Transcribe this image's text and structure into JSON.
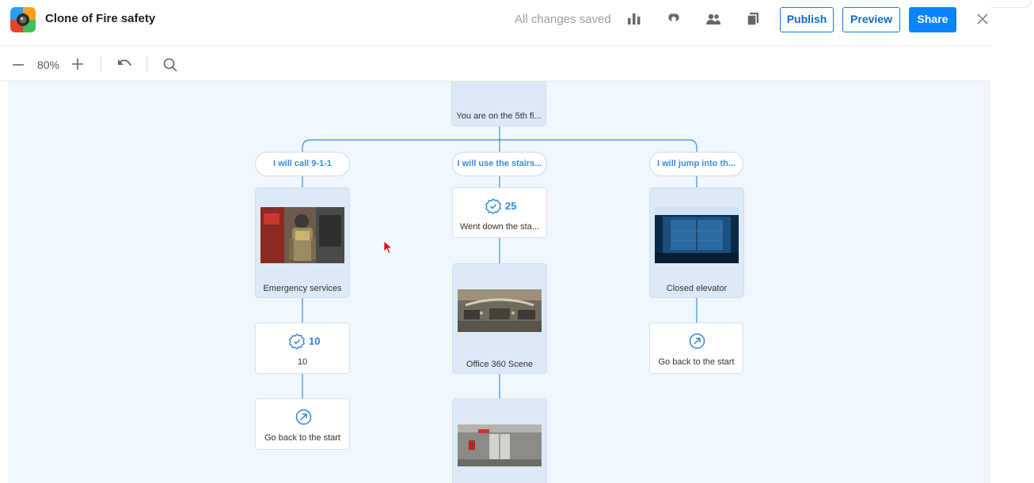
{
  "header": {
    "project_title": "Clone of Fire safety",
    "save_status": "All changes saved",
    "buttons": {
      "publish": "Publish",
      "preview": "Preview",
      "share": "Share"
    },
    "icons": [
      "stats-icon",
      "settings-icon",
      "collaborators-icon",
      "duplicate-icon",
      "close-icon"
    ]
  },
  "toolbar": {
    "zoom_level": "80%"
  },
  "tree": {
    "root": {
      "label": "You are on the 5th fl..."
    },
    "choices": [
      {
        "label": "I will call 9-1-1"
      },
      {
        "label": "I will use the stairs..."
      },
      {
        "label": "I will jump into th..."
      }
    ],
    "left": {
      "scene": {
        "label": "Emergency services"
      },
      "score": {
        "value": "10",
        "label": "10"
      },
      "end": {
        "label": "Go back to the start"
      }
    },
    "middle": {
      "score": {
        "value": "25",
        "label": "Went down the sta..."
      },
      "scene": {
        "label": "Office 360 Scene"
      }
    },
    "right": {
      "scene": {
        "label": "Closed elevator"
      },
      "end": {
        "label": "Go back to the start"
      }
    }
  },
  "colors": {
    "accent": "#0a84ff",
    "canvas_bg": "#f0f7fd",
    "connector": "#3a8de0"
  }
}
